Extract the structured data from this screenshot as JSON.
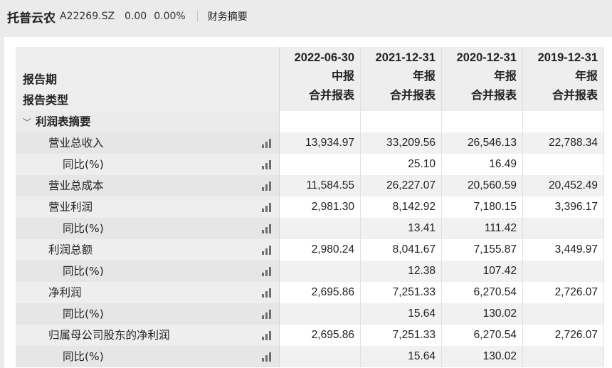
{
  "header": {
    "name": "托普云农",
    "code": "A22269.SZ",
    "price": "0.00",
    "change_pct": "0.00%",
    "tab": "财务摘要"
  },
  "table": {
    "row_labels": {
      "period": "报告期",
      "type": "报告类型"
    },
    "columns": [
      {
        "date": "2022-06-30",
        "period": "中报",
        "type": "合并报表"
      },
      {
        "date": "2021-12-31",
        "period": "年报",
        "type": "合并报表"
      },
      {
        "date": "2020-12-31",
        "period": "年报",
        "type": "合并报表"
      },
      {
        "date": "2019-12-31",
        "period": "年报",
        "type": "合并报表"
      }
    ],
    "section": {
      "label": "利润表摘要",
      "chevron": "chevron-down-icon"
    },
    "rows": [
      {
        "label": "营业总收入",
        "level": 1,
        "values": [
          "13,934.97",
          "33,209.56",
          "26,546.13",
          "22,788.34"
        ]
      },
      {
        "label": "同比(%)",
        "level": 2,
        "values": [
          "",
          "25.10",
          "16.49",
          ""
        ]
      },
      {
        "label": "营业总成本",
        "level": 1,
        "values": [
          "11,584.55",
          "26,227.07",
          "20,560.59",
          "20,452.49"
        ]
      },
      {
        "label": "营业利润",
        "level": 1,
        "values": [
          "2,981.30",
          "8,142.92",
          "7,180.15",
          "3,396.17"
        ]
      },
      {
        "label": "同比(%)",
        "level": 2,
        "values": [
          "",
          "13.41",
          "111.42",
          ""
        ]
      },
      {
        "label": "利润总额",
        "level": 1,
        "values": [
          "2,980.24",
          "8,041.67",
          "7,155.87",
          "3,449.97"
        ]
      },
      {
        "label": "同比(%)",
        "level": 2,
        "values": [
          "",
          "12.38",
          "107.42",
          ""
        ]
      },
      {
        "label": "净利润",
        "level": 1,
        "values": [
          "2,695.86",
          "7,251.33",
          "6,270.54",
          "2,726.07"
        ]
      },
      {
        "label": "同比(%)",
        "level": 2,
        "values": [
          "",
          "15.64",
          "130.02",
          ""
        ]
      },
      {
        "label": "归属母公司股东的净利润",
        "level": 1,
        "values": [
          "2,695.86",
          "7,251.33",
          "6,270.54",
          "2,726.07"
        ]
      },
      {
        "label": "同比(%)",
        "level": 2,
        "values": [
          "",
          "15.64",
          "130.02",
          ""
        ]
      }
    ],
    "row_icon": "bar-chart-icon"
  }
}
